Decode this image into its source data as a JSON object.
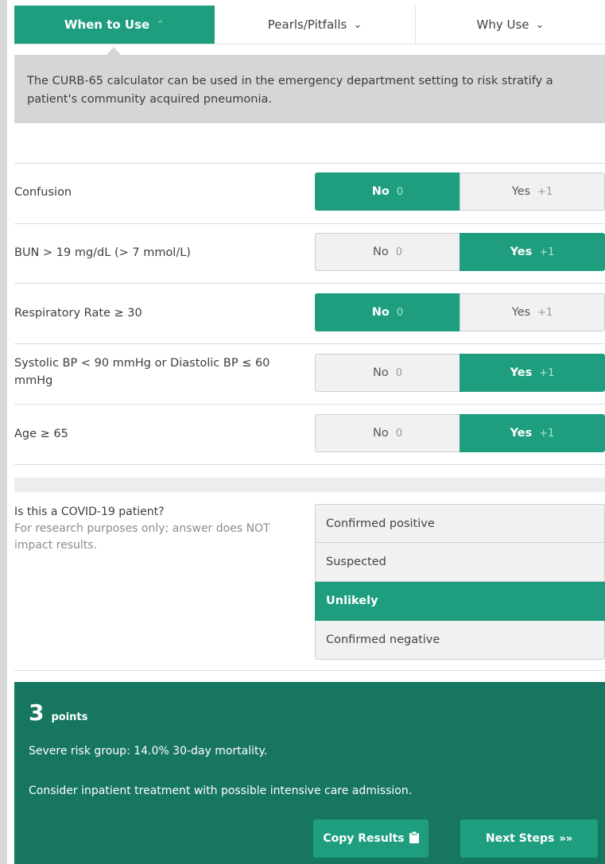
{
  "tabs": [
    {
      "label": "When to Use",
      "chevron": "⌃",
      "active": true
    },
    {
      "label": "Pearls/Pitfalls",
      "chevron": "⌄"
    },
    {
      "label": "Why Use",
      "chevron": "⌄"
    }
  ],
  "info_text": "The CURB-65 calculator can be used in the emergency department setting to risk stratify a patient's community acquired pneumonia.",
  "criteria": [
    {
      "label": "Confusion",
      "no": "No",
      "no_pts": "0",
      "yes": "Yes",
      "yes_pts": "+1",
      "selected": "No"
    },
    {
      "label": "BUN > 19 mg/dL (> 7 mmol/L)",
      "no": "No",
      "no_pts": "0",
      "yes": "Yes",
      "yes_pts": "+1",
      "selected": "Yes"
    },
    {
      "label": "Respiratory Rate ≥ 30",
      "no": "No",
      "no_pts": "0",
      "yes": "Yes",
      "yes_pts": "+1",
      "selected": "No"
    },
    {
      "label": "Systolic BP < 90 mmHg or Diastolic BP ≤ 60 mmHg",
      "no": "No",
      "no_pts": "0",
      "yes": "Yes",
      "yes_pts": "+1",
      "selected": "Yes"
    },
    {
      "label": "Age ≥ 65",
      "no": "No",
      "no_pts": "0",
      "yes": "Yes",
      "yes_pts": "+1",
      "selected": "Yes"
    }
  ],
  "covid": {
    "question": "Is this a COVID-19 patient?",
    "note": "For research purposes only; answer does NOT impact results.",
    "options": [
      "Confirmed positive",
      "Suspected",
      "Unlikely",
      "Confirmed negative"
    ],
    "selected": "Unlikely"
  },
  "result": {
    "score": "3",
    "unit": "points",
    "risk": "Severe risk group: 14.0% 30-day mortality.",
    "recommendation": "Consider inpatient treatment with possible intensive care admission.",
    "copy_label": "Copy Results",
    "copy_icon": "📋",
    "next_label": "Next Steps",
    "next_icon": "»»"
  },
  "colors": {
    "accent": "#1e9e7e",
    "result_bg": "#17765f",
    "info_bg": "#d6d6d6"
  }
}
